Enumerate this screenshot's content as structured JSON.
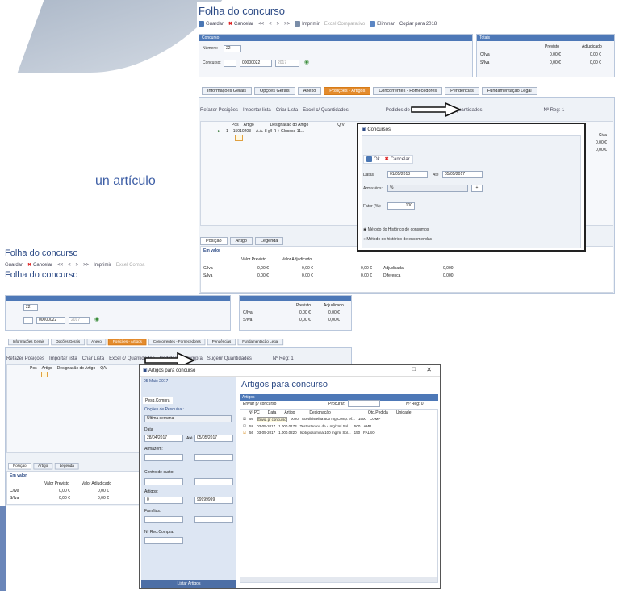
{
  "side_text": "un artículo",
  "top_window": {
    "title": "Folha do concurso",
    "toolbar": [
      "Guardar",
      "Cancelar",
      "<<",
      "<",
      ">",
      ">>",
      "Imprimir",
      "Excel Comparativo",
      "Eliminar",
      "Copiar para 2018"
    ],
    "concurso_hdr": "Concurso",
    "totais_hdr": "Totais",
    "numero_label": "Número:",
    "numero_value": "22",
    "concurso_label": "Concurso:",
    "concurso_value": "00000022",
    "year": "2017",
    "totais_cols": [
      "Previsto",
      "Adjudicado"
    ],
    "totais_rows": [
      {
        "l": "C/Iva",
        "p": "0,00 €",
        "a": "0,00 €"
      },
      {
        "l": "S/Iva",
        "p": "0,00 €",
        "a": "0,00 €"
      }
    ],
    "tabs": [
      "Informações Gerais",
      "Opções Gerais",
      "Anexo",
      "Posições - Artigos",
      "Concorrentes - Fornecedores",
      "Pendências",
      "Fundamentação Legal"
    ],
    "subtoolbar": [
      "Refazer Posições",
      "Importar lista",
      "Criar Lista",
      "Excel c/ Quantidades",
      "Pedidos de Compra",
      "Sugerir Quantidades",
      "Nº Reg: 1"
    ],
    "grid_headers": [
      "Pos",
      "Artigo",
      "Designação do Artigo",
      "Q/V"
    ],
    "grid_row": {
      "pos": "1",
      "artigo": "15010203",
      "desig": "A.A. 8 g/l R + Glucose 11..."
    },
    "bottom_tabs": [
      "Posição",
      "Artigo",
      "Legenda"
    ],
    "em_valor": "Em valor",
    "val_cols": [
      "Valor Previsto",
      "Valor Adjudicado"
    ],
    "val_rows": [
      {
        "l": "C/Iva",
        "p": "0,00 €",
        "a": "0,00 €",
        "c": "0,00 €"
      },
      {
        "l": "S/Iva",
        "p": "0,00 €",
        "a": "0,00 €",
        "c": "0,00 €"
      }
    ],
    "adjudicada": "Adjudicada",
    "diferenca": "Diferença",
    "adj_val": "0,000",
    "dif_val": "0,000",
    "right_vals": [
      "Civa",
      "0,00 €",
      "0,00 €"
    ]
  },
  "concursos_dialog": {
    "title": "Concursos",
    "ok": "Ok",
    "cancelar": "Cancelar",
    "datas_label": "Datas:",
    "date_from": "01/05/2018",
    "ate": "Até",
    "date_to": "05/05/2017",
    "armazens_label": "Armazéns:",
    "armazens_value": "%",
    "fator_label": "Fator (%):",
    "fator_value": "100",
    "radio1": "Método do Histórico de consumos",
    "radio2": "Método do histórico de encomendas"
  },
  "bottom_window": {
    "title1": "Folha do concurso",
    "title2": "Folha do concurso",
    "toolbar": [
      "Guardar",
      "Cancelar",
      "<<",
      "<",
      ">",
      ">>",
      "Imprimir",
      "Excel Compa"
    ],
    "numero_value": "22",
    "concurso_value": "00000022",
    "year": "2017",
    "totais_cols": [
      "Previsto",
      "Adjudicado"
    ],
    "totais_rows": [
      {
        "l": "C/Iva",
        "p": "0,00 €",
        "a": "0,00 €"
      },
      {
        "l": "S/Iva",
        "p": "0,00 €",
        "a": "0,00 €"
      }
    ],
    "tabs": [
      "Informações Gerais",
      "Opções Gerais",
      "Anexo",
      "Posições - Artigos",
      "Concorrentes - Fornecedores",
      "Pendências",
      "Fundamentação Legal"
    ],
    "subtoolbar": [
      "Refazer Posições",
      "Importar lista",
      "Criar Lista",
      "Excel c/ Quantidades",
      "Pedidos de Compra",
      "Sugerir Quantidades",
      "Nº Reg: 1"
    ],
    "grid_headers": [
      "Pos",
      "Artigo",
      "Designação do Artigo",
      "Q/V"
    ],
    "bottom_tabs": [
      "Posição",
      "Artigo",
      "Legenda"
    ],
    "em_valor": "Em valor",
    "val_cols": [
      "Valor Previsto",
      "Valor Adjudicado"
    ],
    "val_rows": [
      {
        "l": "C/Iva",
        "p": "0,00 €",
        "a": "0,00 €"
      },
      {
        "l": "S/Iva",
        "p": "0,00 €",
        "a": "0,00 €"
      }
    ]
  },
  "artigos_dialog": {
    "window_title": "Artigos para concurso",
    "heading": "Artigos para concurso",
    "date_label": "05 Maio 2017",
    "left_tab": "Pesq.Compra",
    "opcoes_label": "Opções de Pesquisa :",
    "opcoes_value": "Última semana",
    "data_label": "Data",
    "data_from": "28/04/2017",
    "ate": "Até",
    "data_to": "05/05/2017",
    "armazem_label": "Armazém:",
    "centro_label": "Centro de custo:",
    "artigos_label": "Artigos:",
    "artigo_from": "0",
    "artigo_to": "99999999",
    "familias_label": "Famílias:",
    "requisicao_label": "Nº Req.Compra:",
    "listar_btn": "Listar Artigos",
    "artigos_tab": "Artigos",
    "enviar_label": "Enviar p/ concurso",
    "procurar_label": "Procurar:",
    "nreg": "Nº Reg: 0",
    "cols": [
      "Nº PC",
      "Data",
      "Artigo",
      "Designação",
      "Qtd.Pedida",
      "Unidade"
    ],
    "rows": [
      {
        "pc": "56",
        "data": "Envia p/ concurso",
        "art": "0020",
        "desig": "Acetilcisteína 600 mg Comp. ef...",
        "qtd": "1500",
        "un": "COMP"
      },
      {
        "pc": "58",
        "data": "03-05-2017",
        "art": "1.000.0173",
        "desig": "Testosterona de 4 mg/2ml Sol...",
        "qtd": "500",
        "un": "AMP"
      },
      {
        "pc": "56",
        "data": "03-05-2017",
        "art": "1.000.0220",
        "desig": "Isotoposomina 100 mg/ml Sol...",
        "qtd": "150",
        "un": "FALSO"
      }
    ]
  }
}
